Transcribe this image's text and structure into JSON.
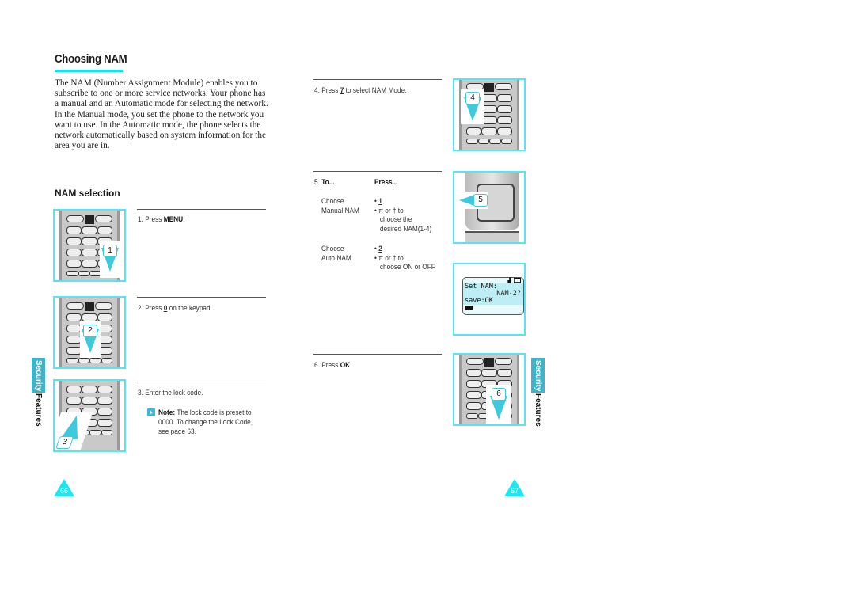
{
  "left_page": {
    "title": "Choosing NAM",
    "intro": "The NAM (Number Assignment Module) enables you to subscribe to one or more service networks. Your phone has a manual and an Automatic mode for selecting the network. In the Manual mode, you set the phone to the network you want to use. In the Automatic mode, the phone selects the network automatically based on system information for the area you are in.",
    "section_heading": "NAM selection",
    "steps": [
      {
        "num": "1.",
        "pre": "Press ",
        "key": "MENU",
        "post": ".",
        "callout": "1"
      },
      {
        "num": "2.",
        "pre": "Press ",
        "key": "0",
        "post": " on the keypad.",
        "callout": "2"
      },
      {
        "num": "3.",
        "text": "Enter the lock code.",
        "callout": "3"
      }
    ],
    "note": {
      "label": "Note:",
      "lines": [
        "The lock code is preset to",
        "0000. To change the Lock Code,",
        "see page 63."
      ]
    },
    "side_tab": {
      "highlight": "Security",
      "text": "Features"
    },
    "page_number": "66"
  },
  "right_page": {
    "step4": {
      "num": "4.",
      "pre": "Press ",
      "key": "7",
      "post": " to select NAM Mode.",
      "callout": "4"
    },
    "step5": {
      "num": "5.",
      "col_to": "To...",
      "col_press": "Press...",
      "rows": [
        {
          "to": [
            "Choose",
            "Manual NAM"
          ],
          "press_key": "1",
          "press_lines": [
            "π  or †  to",
            "choose the",
            "desired NAM(1-4)"
          ]
        },
        {
          "to": [
            "Choose",
            "Auto NAM"
          ],
          "press_key": "2",
          "press_lines": [
            "π  or †  to",
            "choose ON or OFF"
          ]
        }
      ],
      "callout": "5"
    },
    "lcd": {
      "top_icons": [
        "signal-icon",
        "roam-icon"
      ],
      "line1": "Set NAM:",
      "line2": "NAM-2?",
      "line3": "save:OK",
      "battery": "battery-icon"
    },
    "step6": {
      "num": "6.",
      "pre": "Press ",
      "key": "OK",
      "post": ".",
      "callout": "6"
    },
    "side_tab": {
      "highlight": "Security",
      "text": "Features"
    },
    "page_number": "67"
  },
  "colors": {
    "accent": "#19e0ee",
    "tab": "#3fb3c9",
    "callout": "#3ec9dc"
  }
}
